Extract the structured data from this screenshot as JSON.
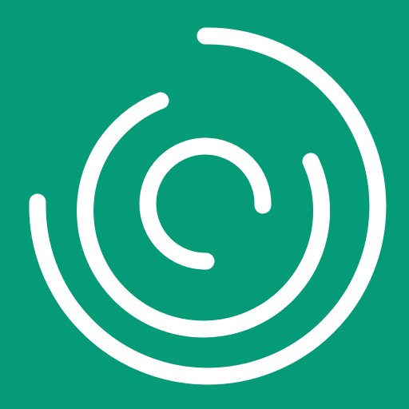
{
  "icon": {
    "name": "concentric-arcs-logo-icon",
    "colors": {
      "background": "#059b78",
      "stroke": "#ffffff"
    }
  }
}
